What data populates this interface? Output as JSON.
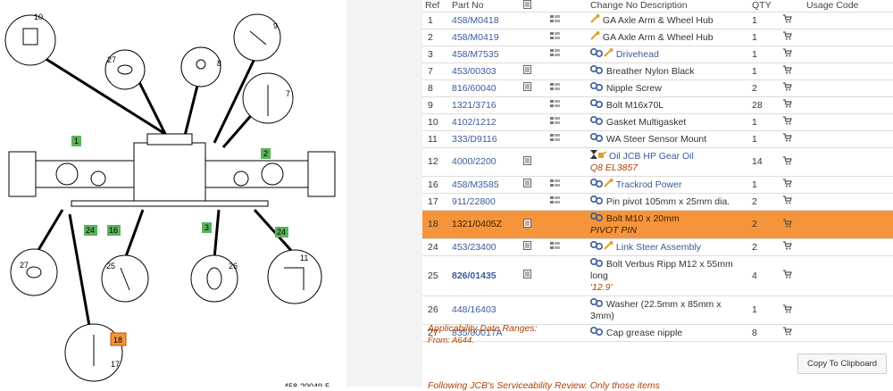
{
  "diagram": {
    "callouts": [
      "10",
      "9",
      "27",
      "8",
      "7",
      "1",
      "2",
      "3",
      "24",
      "16",
      "24",
      "27",
      "25",
      "26",
      "11",
      "18",
      "17"
    ],
    "footer_text": "458-20049-5"
  },
  "table": {
    "headers": {
      "ref": "Ref",
      "part_no": "Part No",
      "change_no": "Change No",
      "description": "Description",
      "qty": "QTY",
      "usage_code": "Usage Code"
    },
    "rows": [
      {
        "ref": "1",
        "part_no": "458/M0418",
        "desc": "GA Axle Arm & Wheel Hub",
        "qty": "1"
      },
      {
        "ref": "2",
        "part_no": "458/M0419",
        "desc": "GA Axle Arm & Wheel Hub",
        "qty": "1"
      },
      {
        "ref": "3",
        "part_no": "458/M7535",
        "desc": "Drivehead",
        "qty": "1"
      },
      {
        "ref": "7",
        "part_no": "453/00303",
        "desc": "Breather Nylon Black",
        "qty": "1"
      },
      {
        "ref": "8",
        "part_no": "816/60040",
        "desc": "Nipple Screw",
        "qty": "2"
      },
      {
        "ref": "9",
        "part_no": "1321/3716",
        "desc": "Bolt M16x70L",
        "qty": "28"
      },
      {
        "ref": "10",
        "part_no": "4102/1212",
        "desc": "Gasket Multigasket",
        "qty": "1"
      },
      {
        "ref": "11",
        "part_no": "333/D9116",
        "desc": "WA Steer Sensor Mount",
        "qty": "1"
      },
      {
        "ref": "12",
        "part_no": "4000/2200",
        "desc": "Oil JCB HP Gear Oil",
        "note": "Q8 EL3857",
        "qty": "14"
      },
      {
        "ref": "16",
        "part_no": "458/M3585",
        "desc": "Trackrod Power",
        "qty": "1"
      },
      {
        "ref": "17",
        "part_no": "911/22800",
        "desc": "Pin pivot 105mm x 25mm dia.",
        "qty": "2"
      },
      {
        "ref": "18",
        "part_no": "1321/0405Z",
        "desc": "Bolt M10 x 20mm",
        "note": "PIVOT PIN",
        "qty": "2"
      },
      {
        "ref": "24",
        "part_no": "453/23400",
        "desc": "Link Steer Assembly",
        "qty": "2"
      },
      {
        "ref": "25",
        "part_no": "826/01435",
        "desc": "Bolt Verbus Ripp M12 x 55mm long",
        "note": "'12.9'",
        "qty": "4"
      },
      {
        "ref": "26",
        "part_no": "448/16403",
        "desc": "Washer (22.5mm x 85mm x 3mm)",
        "qty": "1"
      },
      {
        "ref": "27",
        "part_no": "835/00017A",
        "desc": "Cap grease nipple",
        "qty": "8"
      }
    ]
  },
  "applicability": {
    "title": "Applicability Date Ranges:",
    "from": "From: A644."
  },
  "copy_button": "Copy To Clipboard",
  "following_text": "Following JCB's Serviceability Review. Only those items",
  "colors": {
    "highlight": "#f5943b",
    "link": "#3a5a9a",
    "note": "#b04000",
    "callout_green": "#5bb35b",
    "callout_orange": "#f5943b"
  }
}
